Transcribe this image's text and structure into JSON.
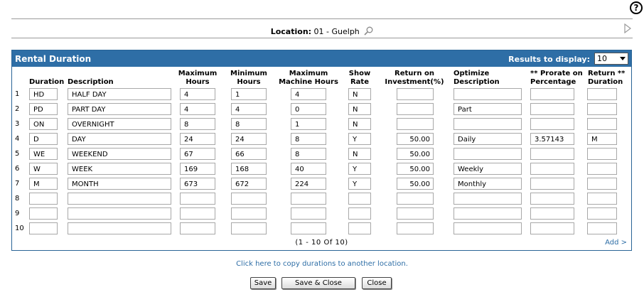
{
  "help_icon_glyph": "?",
  "location": {
    "label": "Location:",
    "value": "01 - Guelph"
  },
  "panel": {
    "title": "Rental Duration",
    "results_label": "Results to display:",
    "results_value": "10"
  },
  "columns": {
    "duration": "Duration",
    "description": "Description",
    "max_hours": [
      "Maximum",
      "Hours"
    ],
    "min_hours": [
      "Minimum",
      "Hours"
    ],
    "max_machine_hours": [
      "Maximum",
      "Machine Hours"
    ],
    "show_rate": [
      "Show",
      "Rate"
    ],
    "roi": [
      "Return on",
      "Investment(%)"
    ],
    "optimize": [
      "Optimize",
      "Description"
    ],
    "prorate": [
      "** Prorate on",
      "Percentage"
    ],
    "return_duration": [
      "Return **",
      "Duration"
    ]
  },
  "rows": [
    {
      "n": "1",
      "duration": "HD",
      "description": "HALF DAY",
      "max_hours": "4",
      "min_hours": "1",
      "max_machine": "4",
      "show_rate": "N",
      "roi": "",
      "optimize": "",
      "prorate": "",
      "return_duration": ""
    },
    {
      "n": "2",
      "duration": "PD",
      "description": "PART DAY",
      "max_hours": "4",
      "min_hours": "4",
      "max_machine": "0",
      "show_rate": "N",
      "roi": "",
      "optimize": "Part",
      "prorate": "",
      "return_duration": ""
    },
    {
      "n": "3",
      "duration": "ON",
      "description": "OVERNIGHT",
      "max_hours": "8",
      "min_hours": "8",
      "max_machine": "1",
      "show_rate": "N",
      "roi": "",
      "optimize": "",
      "prorate": "",
      "return_duration": ""
    },
    {
      "n": "4",
      "duration": "D",
      "description": "DAY",
      "max_hours": "24",
      "min_hours": "24",
      "max_machine": "8",
      "show_rate": "Y",
      "roi": "50.00",
      "optimize": "Daily",
      "prorate": "3.57143",
      "return_duration": "M"
    },
    {
      "n": "5",
      "duration": "WE",
      "description": "WEEKEND",
      "max_hours": "67",
      "min_hours": "66",
      "max_machine": "8",
      "show_rate": "N",
      "roi": "50.00",
      "optimize": "",
      "prorate": "",
      "return_duration": ""
    },
    {
      "n": "6",
      "duration": "W",
      "description": "WEEK",
      "max_hours": "169",
      "min_hours": "168",
      "max_machine": "40",
      "show_rate": "Y",
      "roi": "50.00",
      "optimize": "Weekly",
      "prorate": "",
      "return_duration": ""
    },
    {
      "n": "7",
      "duration": "M",
      "description": "MONTH",
      "max_hours": "673",
      "min_hours": "672",
      "max_machine": "224",
      "show_rate": "Y",
      "roi": "50.00",
      "optimize": "Monthly",
      "prorate": "",
      "return_duration": ""
    },
    {
      "n": "8",
      "duration": "",
      "description": "",
      "max_hours": "",
      "min_hours": "",
      "max_machine": "",
      "show_rate": "",
      "roi": "",
      "optimize": "",
      "prorate": "",
      "return_duration": ""
    },
    {
      "n": "9",
      "duration": "",
      "description": "",
      "max_hours": "",
      "min_hours": "",
      "max_machine": "",
      "show_rate": "",
      "roi": "",
      "optimize": "",
      "prorate": "",
      "return_duration": ""
    },
    {
      "n": "10",
      "duration": "",
      "description": "",
      "max_hours": "",
      "min_hours": "",
      "max_machine": "",
      "show_rate": "",
      "roi": "",
      "optimize": "",
      "prorate": "",
      "return_duration": ""
    }
  ],
  "pager": "(1 - 10 Of 10)",
  "add_link": "Add >",
  "copy_link": "Click here to copy durations to another location.",
  "buttons": {
    "save": "Save",
    "save_close": "Save & Close",
    "close": "Close"
  },
  "colors": {
    "header_bg": "#2e6ea6",
    "link": "#2e6ea6"
  },
  "icons": {
    "help": "help-icon",
    "lookup": "magnifier-icon",
    "next": "next-arrow-icon",
    "dropdown": "chevron-down-icon"
  }
}
